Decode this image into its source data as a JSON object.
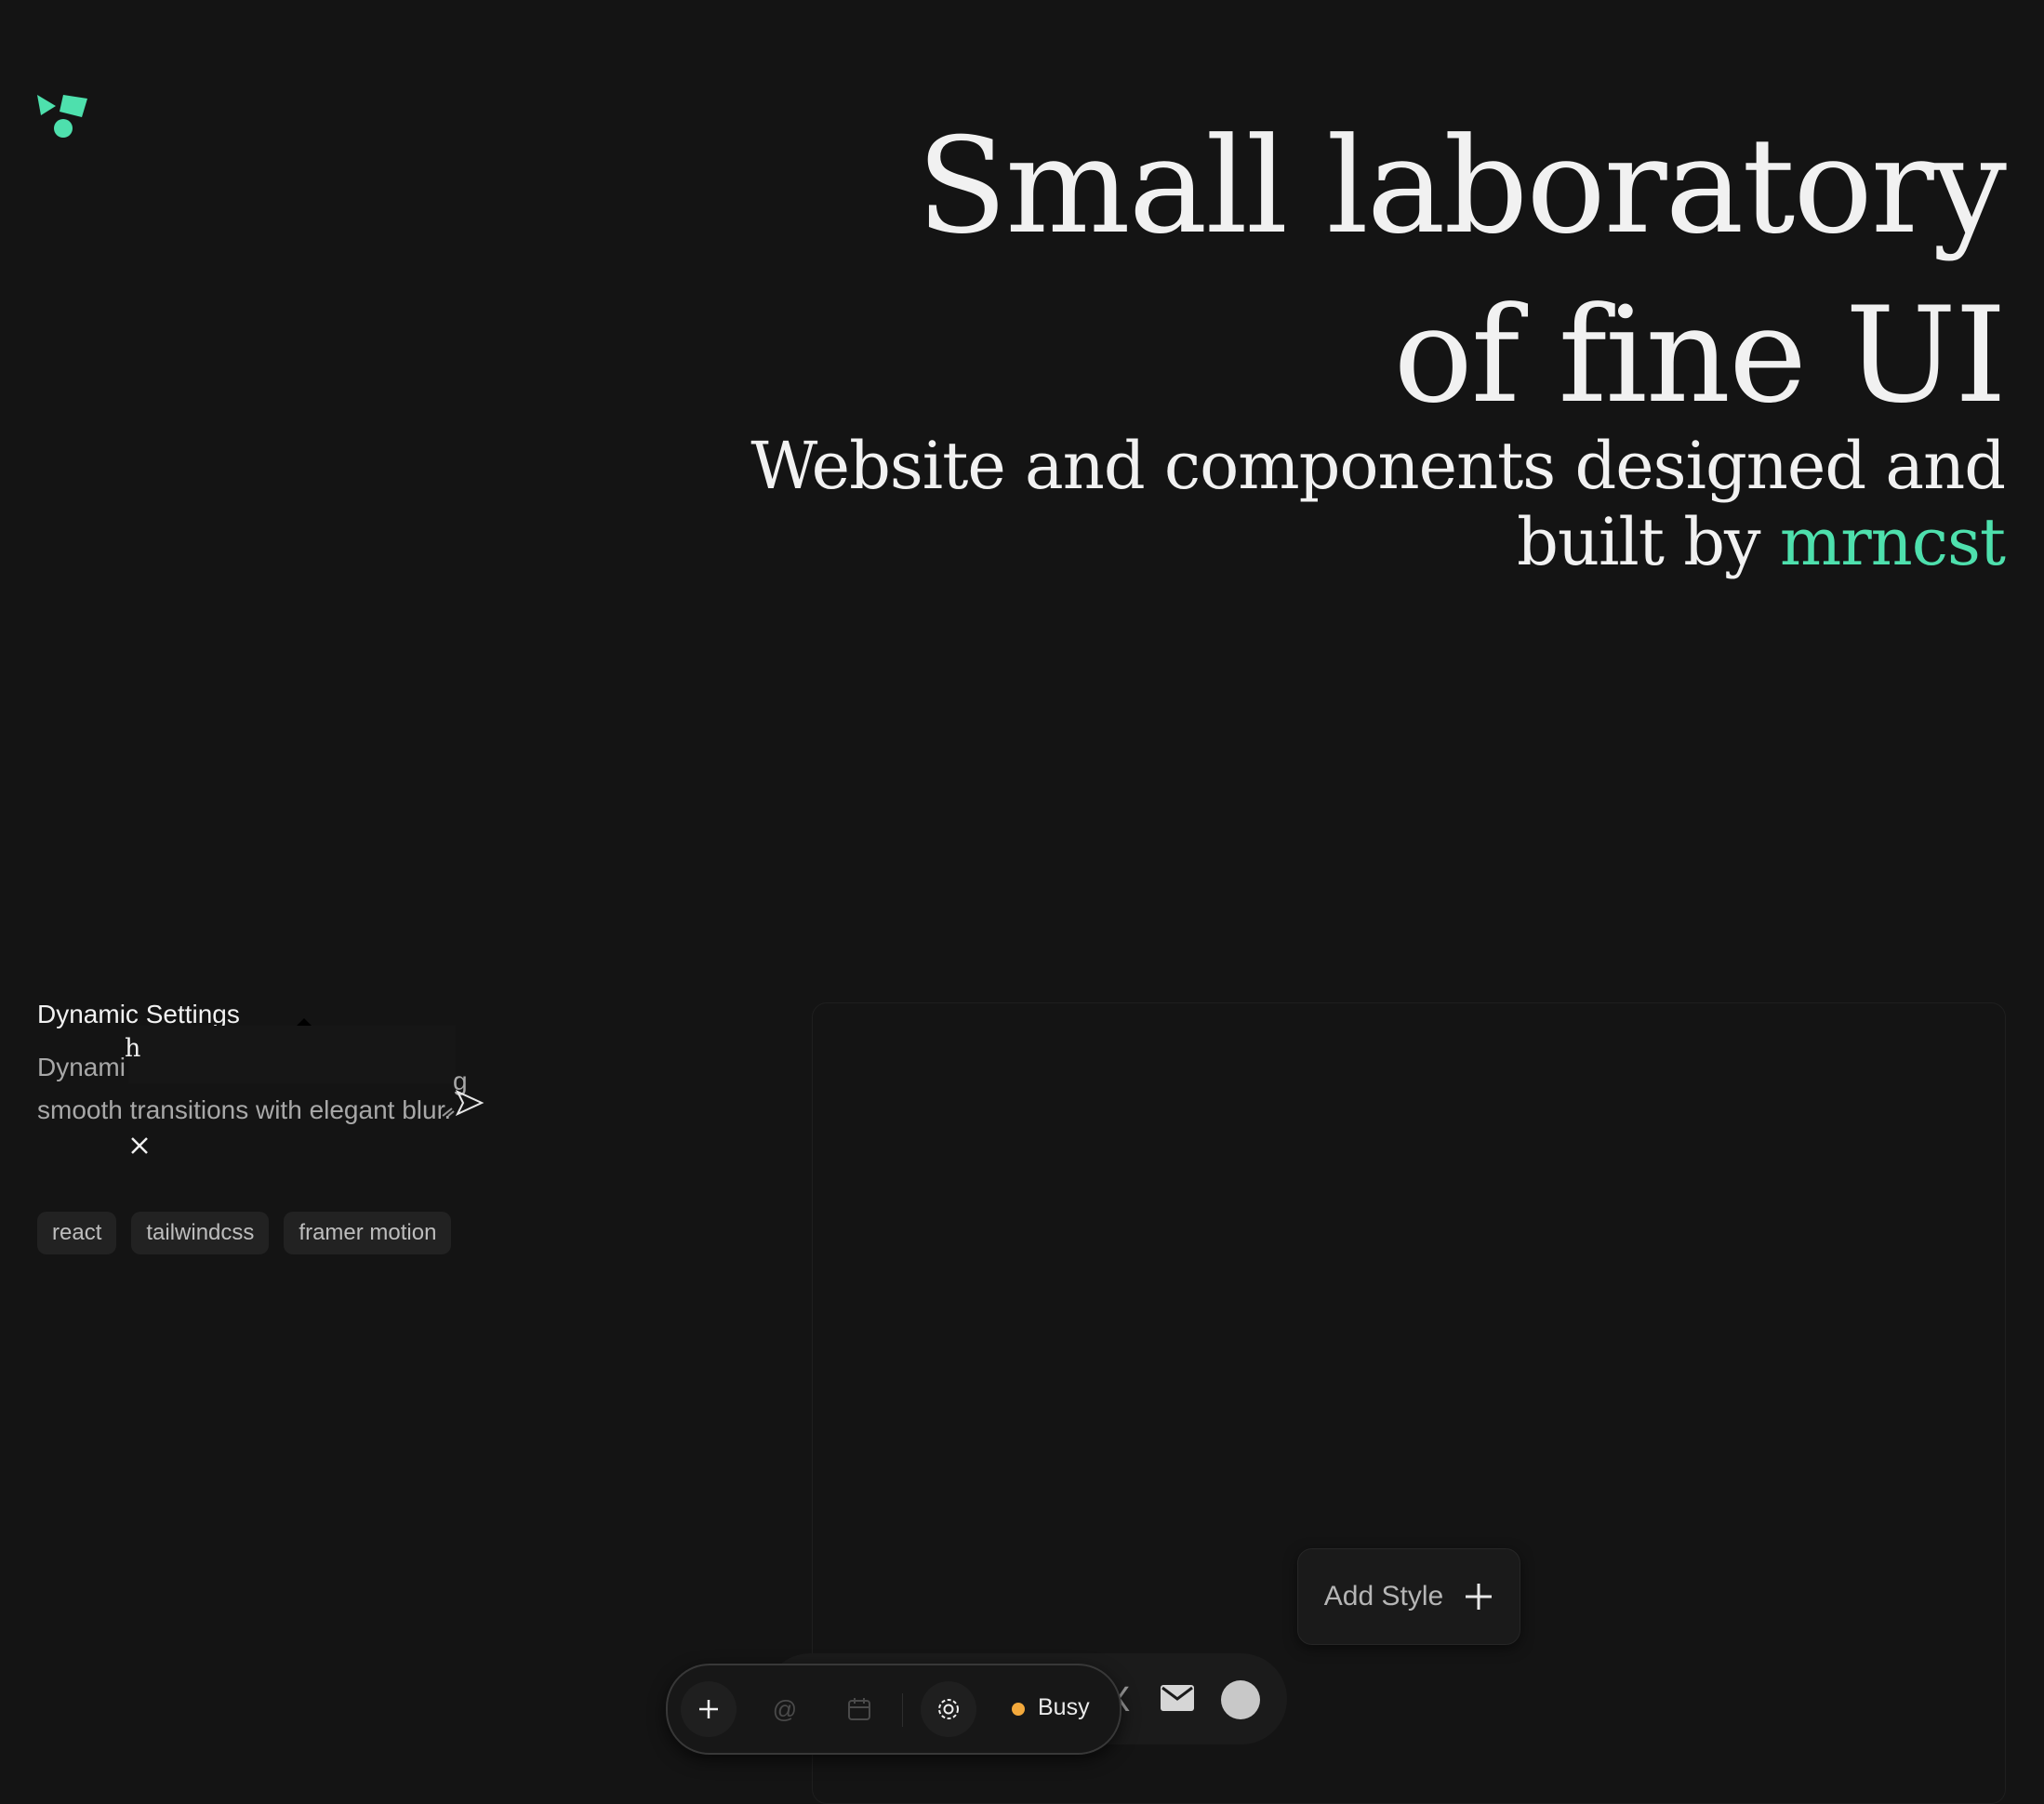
{
  "colors": {
    "background": "#141414",
    "accent": "#4ee0ad",
    "status_busy": "#f3a93c"
  },
  "hero": {
    "title_line1": "Small laboratory",
    "title_line2": "of fine UI",
    "subtitle_line1": "Website and components designed and",
    "subtitle_line2_prefix": "built by ",
    "subtitle_author": "mrncst"
  },
  "component_card": {
    "title": "Dynamic Settings",
    "description_line1_visible": "Dynami",
    "description_line1_end": "g",
    "description_line2": "smooth transitions with elegant blur.",
    "overlay_text": "h",
    "tags": [
      "react",
      "tailwindcss",
      "framer motion"
    ]
  },
  "preview": {
    "add_style_label": "Add Style",
    "back_pill_icons": [
      "x-icon",
      "mail-icon",
      "avatar"
    ]
  },
  "toolbar": {
    "icons": [
      "plus-icon",
      "at-icon",
      "calendar-icon",
      "gear-icon"
    ],
    "at_symbol": "@",
    "status_label": "Busy"
  }
}
